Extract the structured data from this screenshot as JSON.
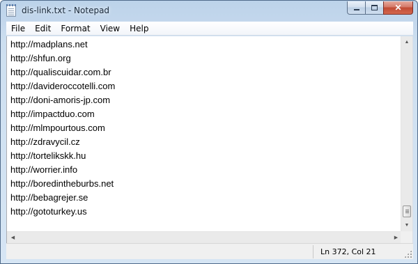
{
  "window": {
    "title": "dis-link.txt - Notepad",
    "icon": "notepad-icon"
  },
  "caption_buttons": {
    "minimize": "minimize-icon",
    "maximize": "maximize-icon",
    "close": "close-icon",
    "close_glyph": "✕"
  },
  "menu": {
    "file": "File",
    "edit": "Edit",
    "format": "Format",
    "view": "View",
    "help": "Help"
  },
  "editor": {
    "lines": [
      "http://madplans.net",
      "http://shfun.org",
      "http://qualiscuidar.com.br",
      "http://davideroccotelli.com",
      "http://doni-amoris-jp.com",
      "http://impactduo.com",
      "http://mlmpourtous.com",
      "http://zdravycil.cz",
      "http://tortelikskk.hu",
      "http://worrier.info",
      "http://boredintheburbs.net",
      "http://bebagrejer.se",
      "http://gototurkey.us"
    ]
  },
  "status": {
    "position": "Ln 372, Col 21"
  },
  "colors": {
    "window_frame": "#bcd3ea",
    "close_button": "#c04a34"
  }
}
